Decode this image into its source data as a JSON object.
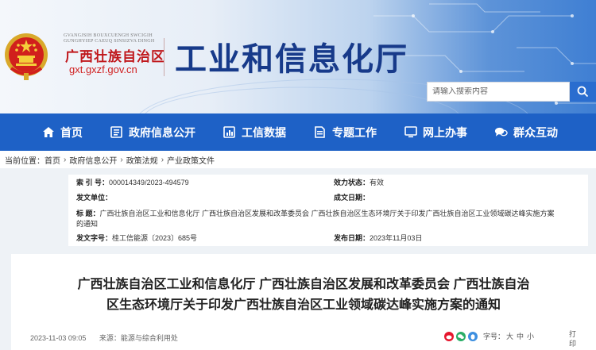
{
  "header": {
    "pinyin": "GVANGJSIH BOUXCUENGH SWCIGIH GUNGHYIEP CAEUQ SINSIZVA DINGH",
    "region_name": "广西壮族自治区",
    "domain": "gxt.gxzf.gov.cn",
    "dept_title": "工业和信息化厅",
    "search_placeholder": "请输入搜索内容"
  },
  "nav": {
    "items": [
      {
        "label": "首页",
        "icon": "home-icon"
      },
      {
        "label": "政府信息公开",
        "icon": "list-icon"
      },
      {
        "label": "工信数据",
        "icon": "chart-icon"
      },
      {
        "label": "专题工作",
        "icon": "document-icon"
      },
      {
        "label": "网上办事",
        "icon": "monitor-icon"
      },
      {
        "label": "群众互动",
        "icon": "chat-icon"
      }
    ]
  },
  "breadcrumb": {
    "prefix": "当前位置：",
    "items": [
      "首页",
      "政府信息公开",
      "政策法规",
      "产业政策文件"
    ],
    "sep": "›"
  },
  "info": {
    "index_label": "索  引 号：",
    "index_value": "000014349/2023-494579",
    "validity_label": "效力状态：",
    "validity_value": "有效",
    "issuer_label": "发文单位：",
    "issuer_value": "",
    "date_label": "成文日期：",
    "date_value": "",
    "title_label": "标      题：",
    "title_value_1": "广西壮族自治区工业和信息化厅 广西壮族自治区发展和改革委员会 广西壮族自治区生态环境厅关于印发广西壮族自治区工业领域碳达峰实施方案",
    "title_value_2": "的通知",
    "docno_label": "发文字号：",
    "docno_value": "桂工信能源〔2023〕685号",
    "pubdate_label": "发布日期：",
    "pubdate_value": "2023年11月03日"
  },
  "article": {
    "title_line1": "广西壮族自治区工业和信息化厅 广西壮族自治区发展和改革委员会 广西壮族自治",
    "title_line2": "区生态环境厅关于印发广西壮族自治区工业领域碳达峰实施方案的通知",
    "datetime": "2023-11-03 09:05",
    "source": "来源：能源与综合利用处",
    "fontsize_label": "字号：",
    "size_large": "大",
    "size_mid": "中",
    "size_small": "小",
    "print_label": "打印"
  },
  "colors": {
    "nav_bg": "#1e61c6",
    "title_blue": "#173a8a",
    "region_red": "#c0181c"
  }
}
